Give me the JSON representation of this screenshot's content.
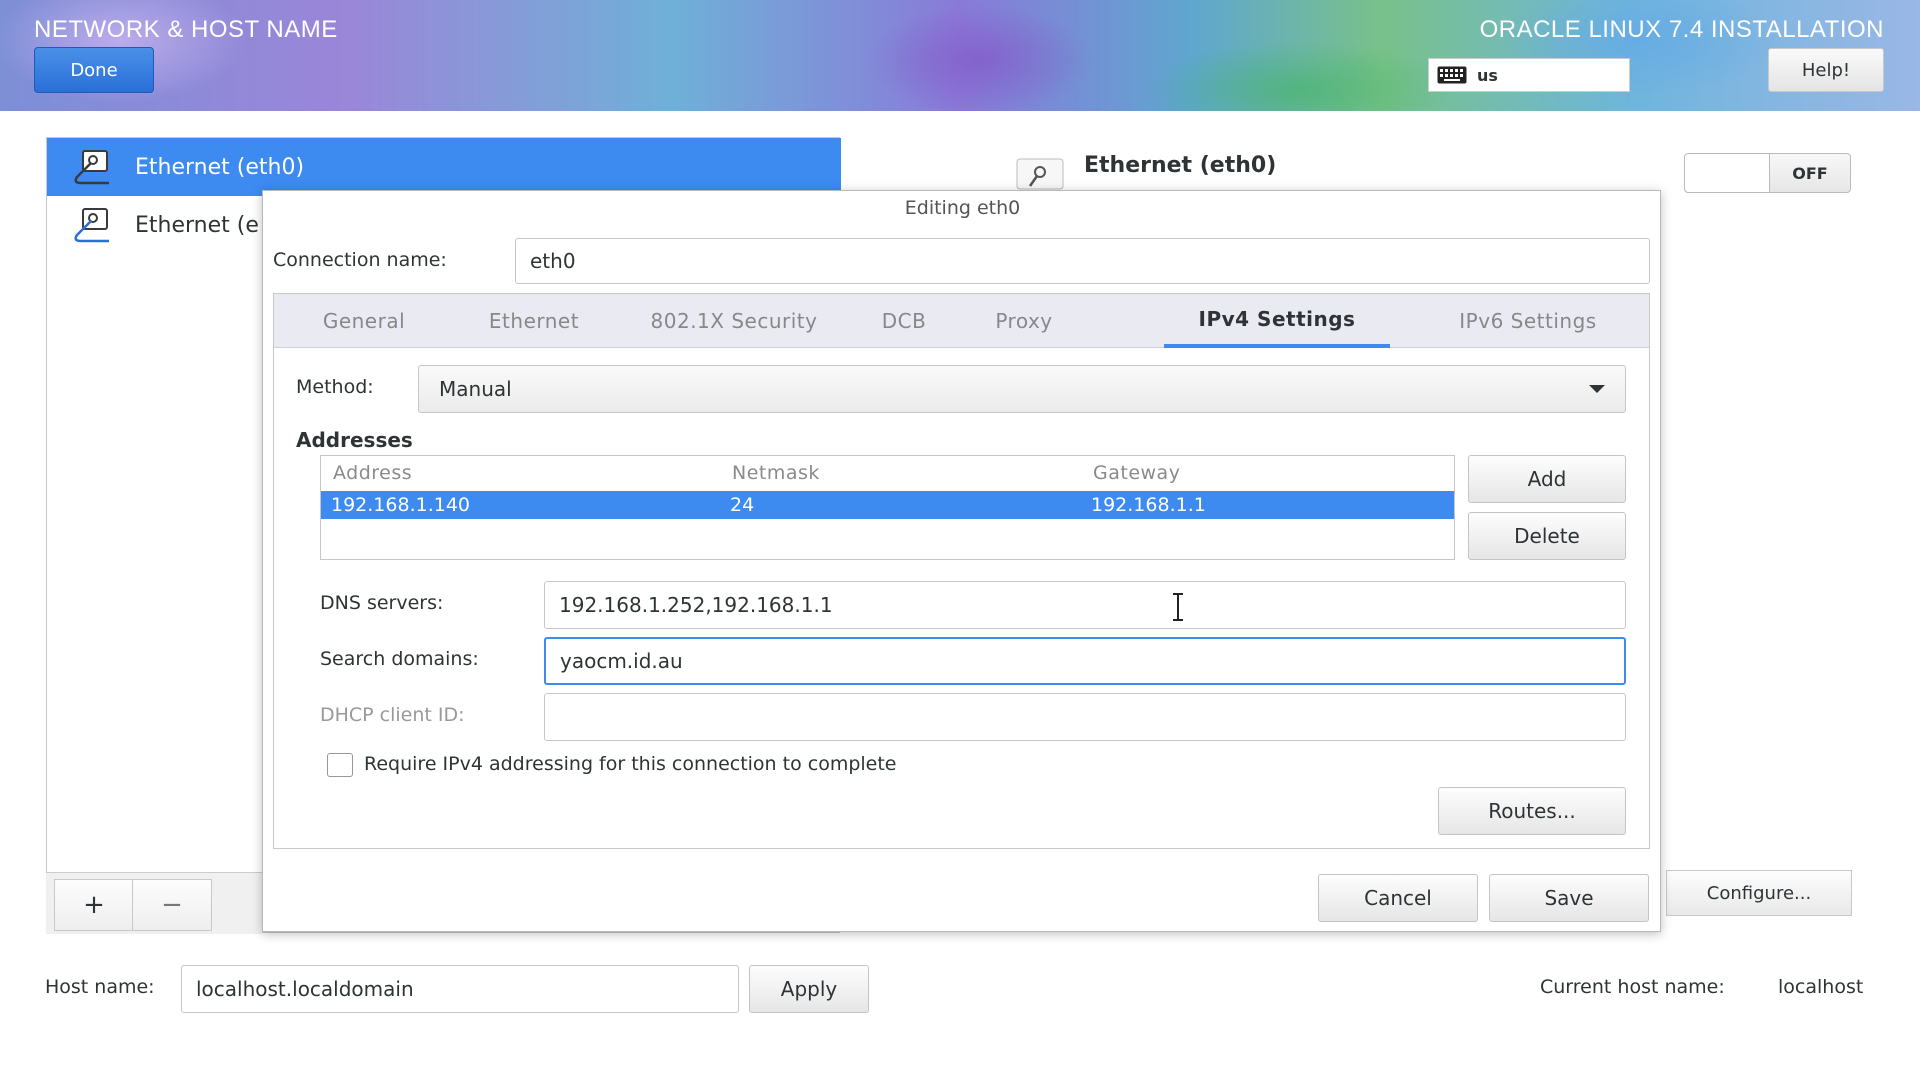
{
  "header": {
    "title": "NETWORK & HOST NAME",
    "done_label": "Done",
    "product": "ORACLE LINUX 7.4 INSTALLATION",
    "keyboard_layout": "us",
    "help_label": "Help!"
  },
  "connections": [
    {
      "label": "Ethernet (eth0)",
      "selected": true
    },
    {
      "label": "Ethernet (e",
      "selected": false
    }
  ],
  "list_toolbar": {
    "add": "+",
    "remove": "−"
  },
  "details": {
    "title": "Ethernet (eth0)",
    "toggle_state": "OFF",
    "configure_label": "Configure..."
  },
  "dialog": {
    "title": "Editing eth0",
    "connection_name_label": "Connection name:",
    "connection_name_value": "eth0",
    "tabs": [
      "General",
      "Ethernet",
      "802.1X Security",
      "DCB",
      "Proxy",
      "IPv4 Settings",
      "IPv6 Settings"
    ],
    "active_tab": "IPv4 Settings",
    "method_label": "Method:",
    "method_value": "Manual",
    "addresses_heading": "Addresses",
    "columns": [
      "Address",
      "Netmask",
      "Gateway"
    ],
    "rows": [
      {
        "address": "192.168.1.140",
        "netmask": "24",
        "gateway": "192.168.1.1"
      }
    ],
    "add_label": "Add",
    "delete_label": "Delete",
    "dns_label": "DNS servers:",
    "dns_value": "192.168.1.252,192.168.1.1",
    "search_label": "Search domains:",
    "search_value": "yaocm.id.au",
    "dhcp_label": "DHCP client ID:",
    "dhcp_value": "",
    "require_label": "Require IPv4 addressing for this connection to complete",
    "require_checked": false,
    "routes_label": "Routes...",
    "cancel_label": "Cancel",
    "save_label": "Save"
  },
  "hostname": {
    "label": "Host name:",
    "value": "localhost.localdomain",
    "apply_label": "Apply",
    "current_label": "Current host name:",
    "current_value": "localhost"
  },
  "colors": {
    "accent": "#3d8bf0",
    "done_button": "#2a6fd6"
  }
}
